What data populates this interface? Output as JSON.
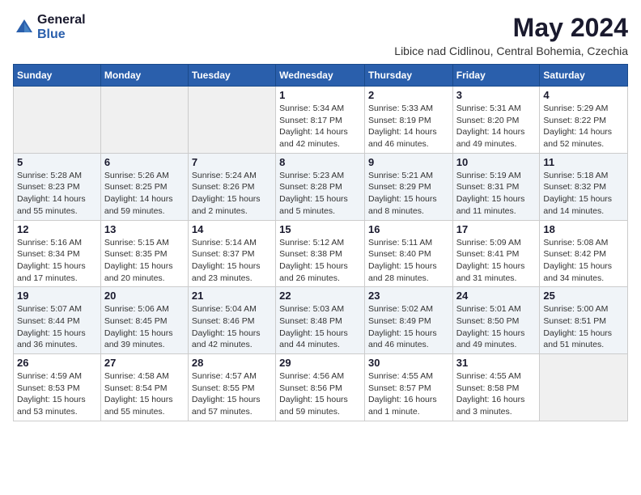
{
  "logo": {
    "general": "General",
    "blue": "Blue"
  },
  "title": "May 2024",
  "location": "Libice nad Cidlinou, Central Bohemia, Czechia",
  "weekdays": [
    "Sunday",
    "Monday",
    "Tuesday",
    "Wednesday",
    "Thursday",
    "Friday",
    "Saturday"
  ],
  "weeks": [
    [
      {
        "day": "",
        "info": ""
      },
      {
        "day": "",
        "info": ""
      },
      {
        "day": "",
        "info": ""
      },
      {
        "day": "1",
        "info": "Sunrise: 5:34 AM\nSunset: 8:17 PM\nDaylight: 14 hours\nand 42 minutes."
      },
      {
        "day": "2",
        "info": "Sunrise: 5:33 AM\nSunset: 8:19 PM\nDaylight: 14 hours\nand 46 minutes."
      },
      {
        "day": "3",
        "info": "Sunrise: 5:31 AM\nSunset: 8:20 PM\nDaylight: 14 hours\nand 49 minutes."
      },
      {
        "day": "4",
        "info": "Sunrise: 5:29 AM\nSunset: 8:22 PM\nDaylight: 14 hours\nand 52 minutes."
      }
    ],
    [
      {
        "day": "5",
        "info": "Sunrise: 5:28 AM\nSunset: 8:23 PM\nDaylight: 14 hours\nand 55 minutes."
      },
      {
        "day": "6",
        "info": "Sunrise: 5:26 AM\nSunset: 8:25 PM\nDaylight: 14 hours\nand 59 minutes."
      },
      {
        "day": "7",
        "info": "Sunrise: 5:24 AM\nSunset: 8:26 PM\nDaylight: 15 hours\nand 2 minutes."
      },
      {
        "day": "8",
        "info": "Sunrise: 5:23 AM\nSunset: 8:28 PM\nDaylight: 15 hours\nand 5 minutes."
      },
      {
        "day": "9",
        "info": "Sunrise: 5:21 AM\nSunset: 8:29 PM\nDaylight: 15 hours\nand 8 minutes."
      },
      {
        "day": "10",
        "info": "Sunrise: 5:19 AM\nSunset: 8:31 PM\nDaylight: 15 hours\nand 11 minutes."
      },
      {
        "day": "11",
        "info": "Sunrise: 5:18 AM\nSunset: 8:32 PM\nDaylight: 15 hours\nand 14 minutes."
      }
    ],
    [
      {
        "day": "12",
        "info": "Sunrise: 5:16 AM\nSunset: 8:34 PM\nDaylight: 15 hours\nand 17 minutes."
      },
      {
        "day": "13",
        "info": "Sunrise: 5:15 AM\nSunset: 8:35 PM\nDaylight: 15 hours\nand 20 minutes."
      },
      {
        "day": "14",
        "info": "Sunrise: 5:14 AM\nSunset: 8:37 PM\nDaylight: 15 hours\nand 23 minutes."
      },
      {
        "day": "15",
        "info": "Sunrise: 5:12 AM\nSunset: 8:38 PM\nDaylight: 15 hours\nand 26 minutes."
      },
      {
        "day": "16",
        "info": "Sunrise: 5:11 AM\nSunset: 8:40 PM\nDaylight: 15 hours\nand 28 minutes."
      },
      {
        "day": "17",
        "info": "Sunrise: 5:09 AM\nSunset: 8:41 PM\nDaylight: 15 hours\nand 31 minutes."
      },
      {
        "day": "18",
        "info": "Sunrise: 5:08 AM\nSunset: 8:42 PM\nDaylight: 15 hours\nand 34 minutes."
      }
    ],
    [
      {
        "day": "19",
        "info": "Sunrise: 5:07 AM\nSunset: 8:44 PM\nDaylight: 15 hours\nand 36 minutes."
      },
      {
        "day": "20",
        "info": "Sunrise: 5:06 AM\nSunset: 8:45 PM\nDaylight: 15 hours\nand 39 minutes."
      },
      {
        "day": "21",
        "info": "Sunrise: 5:04 AM\nSunset: 8:46 PM\nDaylight: 15 hours\nand 42 minutes."
      },
      {
        "day": "22",
        "info": "Sunrise: 5:03 AM\nSunset: 8:48 PM\nDaylight: 15 hours\nand 44 minutes."
      },
      {
        "day": "23",
        "info": "Sunrise: 5:02 AM\nSunset: 8:49 PM\nDaylight: 15 hours\nand 46 minutes."
      },
      {
        "day": "24",
        "info": "Sunrise: 5:01 AM\nSunset: 8:50 PM\nDaylight: 15 hours\nand 49 minutes."
      },
      {
        "day": "25",
        "info": "Sunrise: 5:00 AM\nSunset: 8:51 PM\nDaylight: 15 hours\nand 51 minutes."
      }
    ],
    [
      {
        "day": "26",
        "info": "Sunrise: 4:59 AM\nSunset: 8:53 PM\nDaylight: 15 hours\nand 53 minutes."
      },
      {
        "day": "27",
        "info": "Sunrise: 4:58 AM\nSunset: 8:54 PM\nDaylight: 15 hours\nand 55 minutes."
      },
      {
        "day": "28",
        "info": "Sunrise: 4:57 AM\nSunset: 8:55 PM\nDaylight: 15 hours\nand 57 minutes."
      },
      {
        "day": "29",
        "info": "Sunrise: 4:56 AM\nSunset: 8:56 PM\nDaylight: 15 hours\nand 59 minutes."
      },
      {
        "day": "30",
        "info": "Sunrise: 4:55 AM\nSunset: 8:57 PM\nDaylight: 16 hours\nand 1 minute."
      },
      {
        "day": "31",
        "info": "Sunrise: 4:55 AM\nSunset: 8:58 PM\nDaylight: 16 hours\nand 3 minutes."
      },
      {
        "day": "",
        "info": ""
      }
    ]
  ]
}
